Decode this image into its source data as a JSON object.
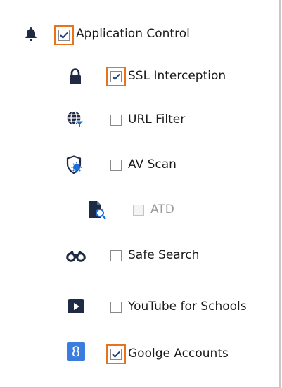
{
  "tree": {
    "items": [
      {
        "label": "Application Control",
        "checked": true,
        "highlighted": true,
        "icon": "bell-icon"
      },
      {
        "label": "SSL Interception",
        "checked": true,
        "highlighted": true,
        "icon": "lock-icon"
      },
      {
        "label": "URL Filter",
        "checked": false,
        "highlighted": false,
        "icon": "globe-filter-icon"
      },
      {
        "label": "AV Scan",
        "checked": false,
        "highlighted": false,
        "icon": "shield-virus-icon"
      },
      {
        "label": "ATD",
        "checked": false,
        "highlighted": false,
        "disabled": true,
        "icon": "document-search-icon"
      },
      {
        "label": "Safe Search",
        "checked": false,
        "highlighted": false,
        "icon": "binoculars-icon"
      },
      {
        "label": "YouTube for Schools",
        "checked": false,
        "highlighted": false,
        "icon": "play-button-icon"
      },
      {
        "label": "Goolge Accounts",
        "checked": true,
        "highlighted": true,
        "icon": "google-icon"
      }
    ]
  },
  "colors": {
    "highlight": "#e8731c",
    "icon_dark": "#1f2a44",
    "icon_blue": "#1d6fd8",
    "google_bg": "#3b7ddd"
  }
}
